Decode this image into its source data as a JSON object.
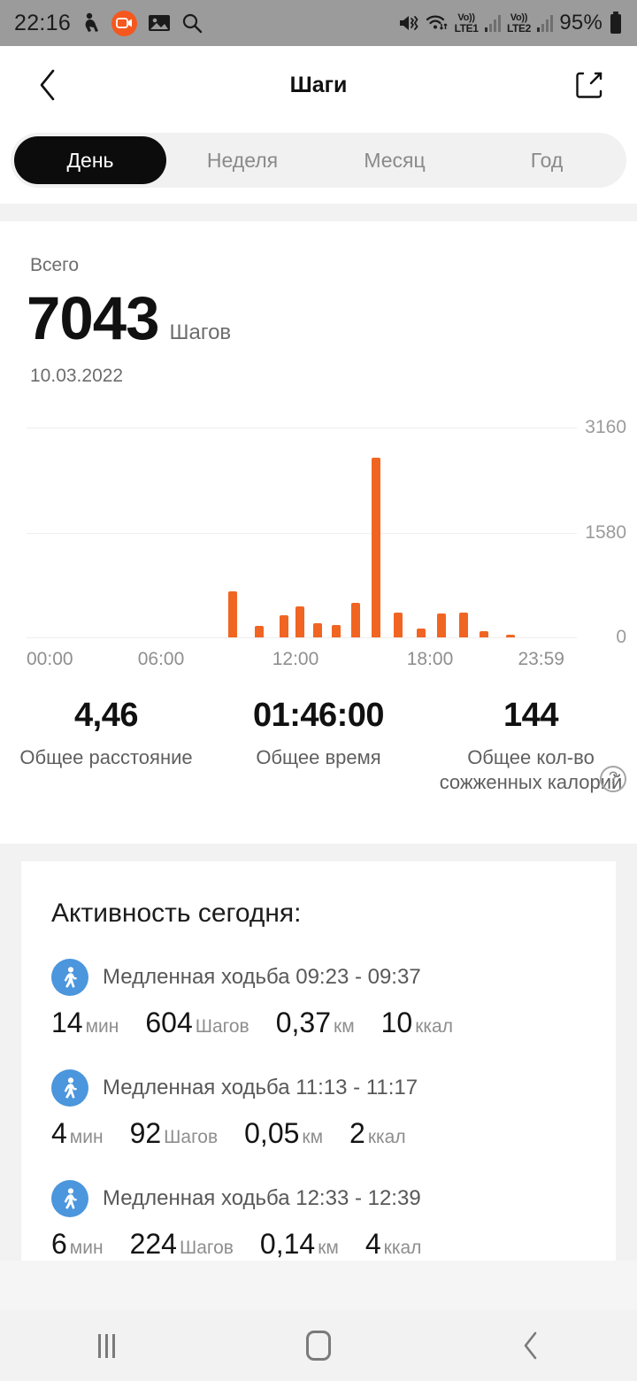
{
  "statusbar": {
    "time": "22:16",
    "battery_percent": "95%",
    "icons": [
      "figure-icon",
      "screen-recorder-icon",
      "gallery-icon",
      "search-icon",
      "mute-vibrate-icon",
      "wifi-icon",
      "volte-lte1-icon",
      "signal-bars-icon",
      "volte-lte2-icon",
      "signal-bars-icon",
      "battery-icon"
    ],
    "volte_label": "Vo))",
    "sim1_label": "LTE1",
    "sim2_label": "LTE2"
  },
  "header": {
    "title": "Шаги",
    "back_icon": "chevron-left-icon",
    "share_icon": "share-external-icon"
  },
  "tabs": [
    {
      "label": "День",
      "active": true
    },
    {
      "label": "Неделя",
      "active": false
    },
    {
      "label": "Месяц",
      "active": false
    },
    {
      "label": "Год",
      "active": false
    }
  ],
  "summary": {
    "label": "Всего",
    "value": "7043",
    "unit": "Шагов",
    "date": "10.03.2022"
  },
  "chart_data": {
    "type": "bar",
    "title": "",
    "xlabel": "",
    "ylabel": "",
    "ylim": [
      0,
      3160
    ],
    "yticks": [
      0,
      1580,
      3160
    ],
    "ytick_labels": [
      "0",
      "1580",
      "3160"
    ],
    "xtick_labels": [
      "00:00",
      "06:00",
      "12:00",
      "18:00",
      "23:59"
    ],
    "xticks_hours": [
      0,
      6,
      12,
      18,
      23.983
    ],
    "grid": true,
    "legend": false,
    "bar_color": "#f16522",
    "x_hours": [
      9.0,
      10.2,
      11.3,
      12.0,
      12.8,
      13.6,
      14.5,
      15.4,
      16.4,
      17.4,
      18.3,
      19.3,
      20.2,
      21.4
    ],
    "values": [
      690,
      170,
      330,
      470,
      215,
      185,
      520,
      2710,
      370,
      135,
      360,
      375,
      95,
      35
    ],
    "categories": [
      "09:00",
      "10:12",
      "11:18",
      "12:00",
      "12:48",
      "13:36",
      "14:30",
      "15:24",
      "16:24",
      "17:24",
      "18:18",
      "19:18",
      "20:12",
      "21:24"
    ]
  },
  "totals": [
    {
      "value": "4,46",
      "caption": "Общее расстояние",
      "help": false
    },
    {
      "value": "01:46:00",
      "caption": "Общее время",
      "help": false
    },
    {
      "value": "144",
      "caption": "Общее кол-во сожженных калорий",
      "help": true,
      "help_glyph": "?"
    }
  ],
  "activity": {
    "title": "Активность сегодня:",
    "items": [
      {
        "icon": "walking-person-icon",
        "name": "Медленная ходьба 09:23 - 09:37",
        "metrics": [
          {
            "value": "14",
            "unit": "мин"
          },
          {
            "value": "604",
            "unit": "Шагов"
          },
          {
            "value": "0,37",
            "unit": "км"
          },
          {
            "value": "10",
            "unit": "ккал"
          }
        ]
      },
      {
        "icon": "walking-person-icon",
        "name": "Медленная ходьба 11:13 - 11:17",
        "metrics": [
          {
            "value": "4",
            "unit": "мин"
          },
          {
            "value": "92",
            "unit": "Шагов"
          },
          {
            "value": "0,05",
            "unit": "км"
          },
          {
            "value": "2",
            "unit": "ккал"
          }
        ]
      },
      {
        "icon": "walking-person-icon",
        "name": "Медленная ходьба 12:33 - 12:39",
        "metrics": [
          {
            "value": "6",
            "unit": "мин"
          },
          {
            "value": "224",
            "unit": "Шагов"
          },
          {
            "value": "0,14",
            "unit": "км"
          },
          {
            "value": "4",
            "unit": "ккал"
          }
        ]
      }
    ]
  },
  "navbar": {
    "recents_icon": "recents-icon",
    "home_icon": "home-icon",
    "back_icon": "back-icon"
  },
  "colors": {
    "accent_orange": "#f16522",
    "activity_blue": "#4b96dd",
    "tab_active_bg": "#0c0c0c"
  }
}
